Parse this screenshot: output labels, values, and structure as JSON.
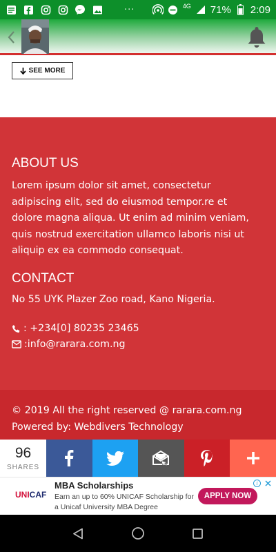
{
  "status_bar": {
    "battery_percent": "71%",
    "time": "2:09",
    "network": "4G",
    "dots": "···"
  },
  "header": {
    "back_icon": "chevron-left-icon",
    "bell_icon": "bell-icon"
  },
  "content": {
    "see_more_label": "SEE MORE"
  },
  "footer": {
    "about_title": "ABOUT US",
    "about_text": "Lorem ipsum dolor sit amet, consectetur adipiscing elit, sed do eiusmod tempor.re et dolore magna aliqua. Ut enim ad minim veniam, quis nostrud exercitation ullamco laboris nisi ut aliquip ex ea commodo consequat.",
    "contact_title": "CONTACT",
    "address": "No 55 UYK Plazer Zoo road, Kano Nigeria.",
    "phone": " : +234[0] 80235 23465",
    "email": ":info@rarara.com.ng",
    "copyright": "© 2019 All the right reserved @ rarara.com.ng",
    "powered": "Powered by: Webdivers Technology"
  },
  "share_bar": {
    "count": "96",
    "count_label": "SHARES",
    "buttons": [
      {
        "name": "facebook",
        "color": "#3b5998"
      },
      {
        "name": "twitter",
        "color": "#1da1f2"
      },
      {
        "name": "email",
        "color": "#555555"
      },
      {
        "name": "pinterest",
        "color": "#cb2027"
      },
      {
        "name": "more",
        "color": "#ff6550"
      }
    ]
  },
  "ad": {
    "logo_prefix": "UNI",
    "logo_suffix": "CAF",
    "title": "MBA Scholarships",
    "description": "Earn an up to 60% UNICAF Scholarship for a Unicaf University MBA Degree",
    "cta": "APPLY NOW"
  },
  "colors": {
    "status_green": "#0d8f2a",
    "footer_red": "#d13438",
    "footer_dark_red": "#c8282d"
  }
}
